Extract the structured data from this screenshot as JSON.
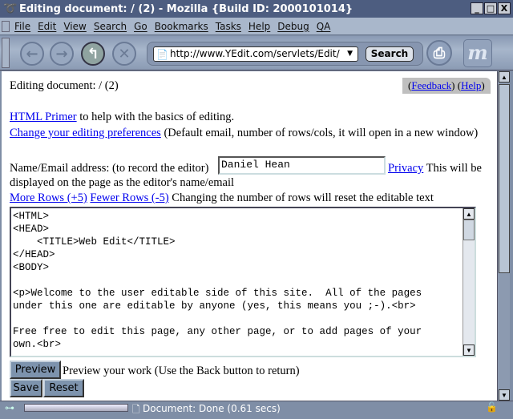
{
  "window": {
    "title": "Editing document: / (2) - Mozilla {Build ID: 2000101014}",
    "buttons": [
      "_",
      "□",
      "X"
    ]
  },
  "menu": [
    "File",
    "Edit",
    "View",
    "Search",
    "Go",
    "Bookmarks",
    "Tasks",
    "Help",
    "Debug",
    "QA"
  ],
  "toolbar": {
    "back": "←",
    "forward": "→",
    "reload": "↰",
    "stop": "✕",
    "url": "http://www.YEdit.com/servlets/Edit/",
    "search_label": "Search",
    "print": "⎙",
    "logo": "m"
  },
  "page": {
    "heading": "Editing document: / (2)",
    "feedback_open": "(",
    "feedback": "Feedback",
    "mid": ") (",
    "help": "Help",
    "close": ")",
    "primer_link": "HTML Primer",
    "primer_text": " to help with the basics of editing.",
    "prefs_link": "Change your editing preferences",
    "prefs_text": " (Default email, number of rows/cols, it will open in a new window)",
    "name_label": "Name/Email address: (to record the editor)",
    "name_value": "Daniel Hean",
    "privacy_link": "Privacy",
    "privacy_text": " This will be",
    "name_note": "displayed on the page as the editor's name/email",
    "more_rows": "More Rows (+5)",
    "fewer_rows": "Fewer Rows (-5)",
    "rows_note": " Changing the number of rows will reset the editable text",
    "editor_text": "<HTML>\n<HEAD>\n    <TITLE>Web Edit</TITLE>\n</HEAD>\n<BODY>\n\n<p>Welcome to the user editable side of this site.  All of the pages\nunder this one are editable by anyone (yes, this means you ;-).<br>\n\nFree free to edit this page, any other page, or to add pages of your\nown.<br>",
    "preview_label": "Preview",
    "preview_text": "Preview your work (Use the Back button to return)",
    "save_label": "Save",
    "reset_label": "Reset"
  },
  "status": {
    "text": "Document: Done (0.61 secs)"
  }
}
